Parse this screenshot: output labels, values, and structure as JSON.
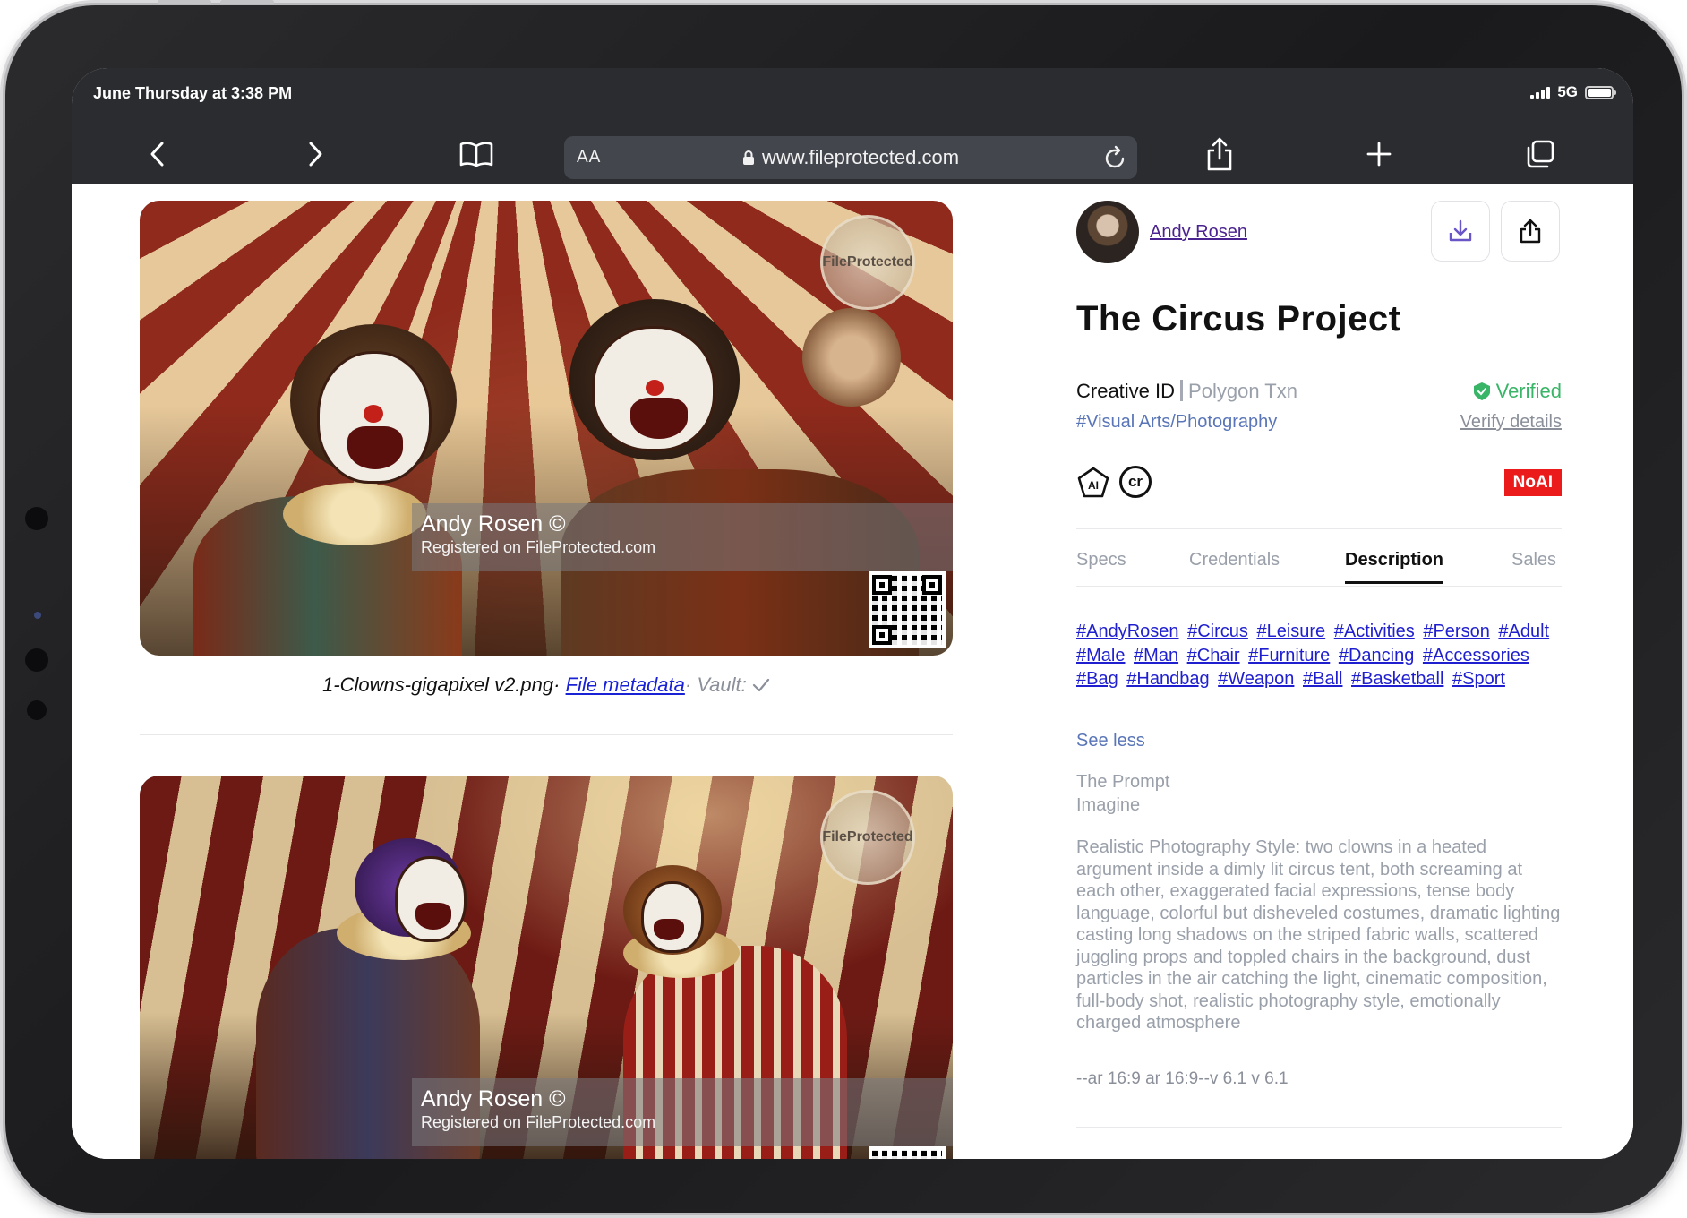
{
  "status": {
    "time": "June Thursday at 3:38 PM",
    "network": "5G"
  },
  "browser": {
    "text_size_label": "AA",
    "url": "www.fileprotected.com",
    "icons": [
      "back-icon",
      "forward-icon",
      "bookmarks-icon",
      "lock-icon",
      "reload-icon",
      "share-icon",
      "new-tab-icon",
      "tabs-icon"
    ]
  },
  "images": [
    {
      "watermark_name": "Andy Rosen ©",
      "watermark_sub": "Registered on FileProtected.com",
      "seal_text": "FileProtected"
    },
    {
      "watermark_name": "Andy Rosen ©",
      "watermark_sub": "Registered on FileProtected.com",
      "seal_text": "FileProtected"
    }
  ],
  "caption": {
    "filename": "1-Clowns-gigapixel v2.png·",
    "metadata_link": "File metadata",
    "vault_label": "· Vault:"
  },
  "panel": {
    "author": "Andy Rosen",
    "title": "The Circus Project",
    "creative_id_label": "Creative ID",
    "polygon_label": "Polygon Txn",
    "verified_label": "Verified",
    "category": "#Visual Arts/Photography",
    "verify_details": "Verify details",
    "ai_badge": "AI",
    "cr_badge": "cr",
    "noai_badge": "NoAI",
    "tabs": [
      "Specs",
      "Credentials",
      "Description",
      "Sales"
    ],
    "active_tab": "Description",
    "tags": [
      "#AndyRosen",
      "#Circus",
      "#Leisure",
      "#Activities",
      "#Person",
      "#Adult",
      "#Male",
      "#Man",
      "#Chair",
      "#Furniture",
      "#Dancing",
      "#Accessories",
      "#Bag",
      "#Handbag",
      "#Weapon",
      "#Ball",
      "#Basketball",
      "#Sport"
    ],
    "see_less": "See less",
    "prompt_heading": "The Prompt",
    "prompt_subheading": "Imagine",
    "prompt_text": "Realistic Photography Style: two clowns in a heated argument inside a dimly lit circus tent, both screaming at each other, exaggerated facial expressions, tense body language, colorful but disheveled costumes, dramatic lighting casting long shadows on the striped fabric walls, scattered juggling props and toppled chairs in the background, dust particles in the air catching the light, cinematic composition, full-body shot, realistic photography style, emotionally charged atmosphere",
    "params": "--ar 16:9 ar 16:9--v 6.1 v 6.1"
  },
  "colors": {
    "toolbar_bg": "#2a2c30",
    "author_link": "#4b2390",
    "tag_link": "#1f1fd0",
    "verified": "#39b567",
    "noai_bg": "#ec1b1b",
    "muted_text": "#9aa0aa"
  }
}
